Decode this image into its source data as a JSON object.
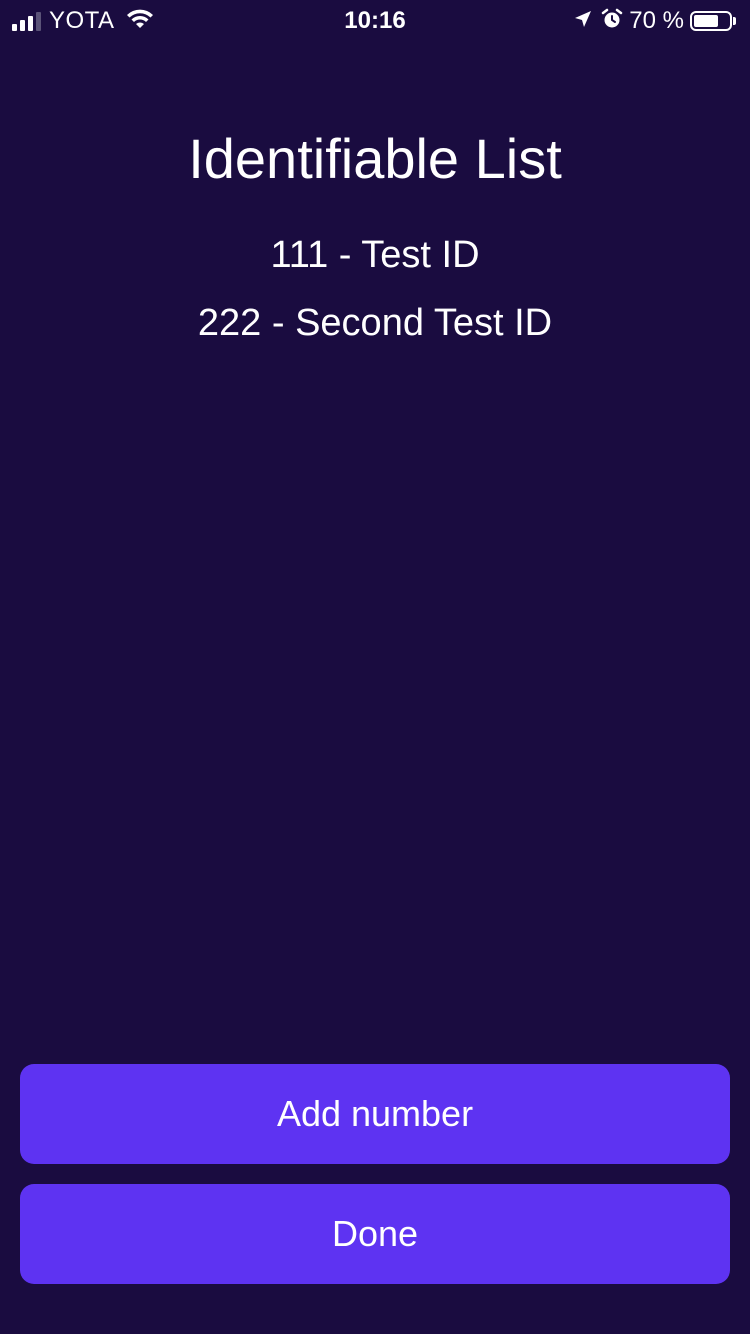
{
  "status_bar": {
    "carrier": "YOTA",
    "time": "10:16",
    "battery_percent": "70 %",
    "battery_level": 0.7,
    "signal_bars_filled": 3,
    "signal_bars_total": 4,
    "icons": [
      "signal-icon",
      "wifi-icon",
      "location-arrow-icon",
      "alarm-icon",
      "battery-icon"
    ]
  },
  "screen": {
    "title": "Identifiable List",
    "items": [
      {
        "label": "111 - Test ID"
      },
      {
        "label": "222 - Second Test ID"
      }
    ]
  },
  "actions": {
    "add_label": "Add number",
    "done_label": "Done"
  },
  "colors": {
    "background": "#1a0c40",
    "button": "#5e33f2",
    "text": "#ffffff"
  }
}
